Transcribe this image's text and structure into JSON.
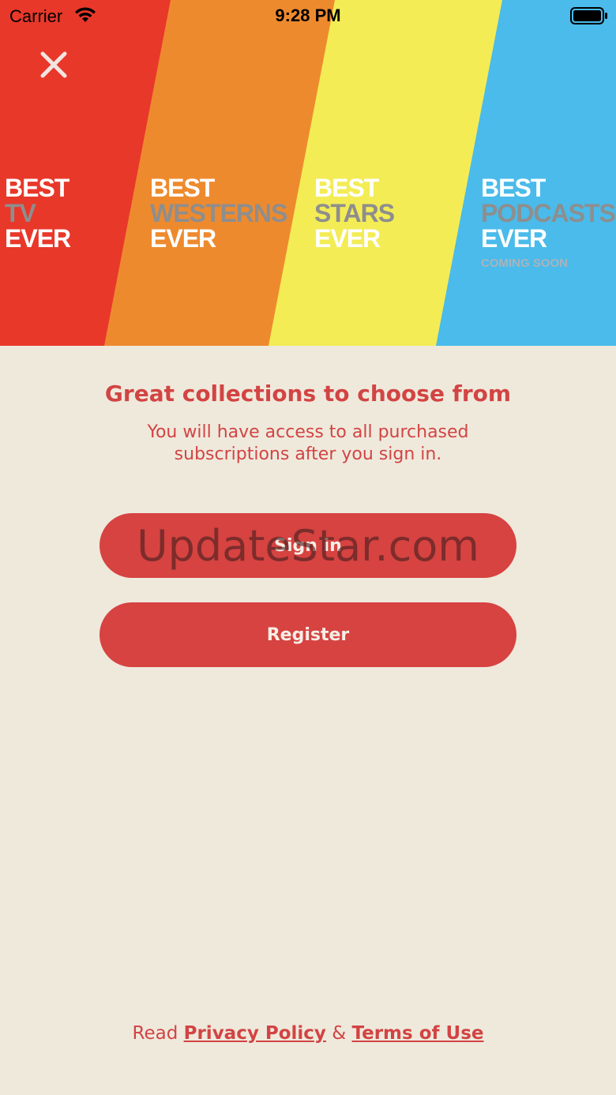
{
  "status_bar": {
    "carrier": "Carrier",
    "time": "9:28 PM"
  },
  "hero": {
    "colors": {
      "red": "#E8382A",
      "orange": "#EE8A2E",
      "yellow": "#F3EC55",
      "blue": "#4ABBEA"
    },
    "blocks": [
      {
        "line1": "BEST",
        "line2": "TV",
        "line3": "EVER",
        "note": ""
      },
      {
        "line1": "BEST",
        "line2": "WESTERNS",
        "line3": "EVER",
        "note": ""
      },
      {
        "line1": "BEST",
        "line2": "STARS",
        "line3": "EVER",
        "note": ""
      },
      {
        "line1": "BEST",
        "line2": "PODCASTS",
        "line3": "EVER",
        "note": "COMING SOON"
      }
    ]
  },
  "content": {
    "headline": "Great collections to choose from",
    "subtitle": "You will have access to all purchased subscriptions after you sign in.",
    "signin_label": "Sign in",
    "register_label": "Register",
    "watermark": "UpdateStar.com"
  },
  "footer": {
    "read": "Read",
    "privacy": "Privacy Policy",
    "amp": "&",
    "terms": "Terms of Use"
  },
  "theme": {
    "accent": "#D64341",
    "background": "#EFE9DC"
  }
}
